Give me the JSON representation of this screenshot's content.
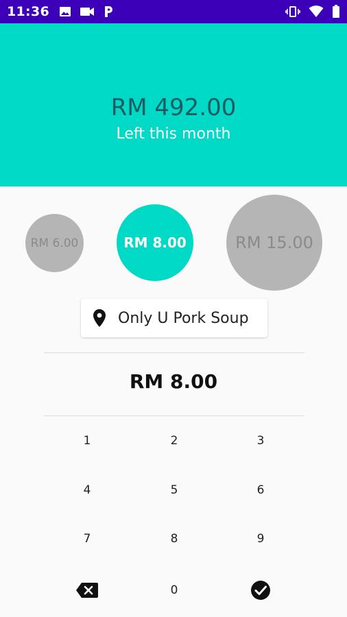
{
  "status_bar": {
    "time": "11:36",
    "icons_left": [
      "image-icon",
      "video-icon",
      "parking-icon"
    ],
    "icons_right": [
      "vibrate-icon",
      "wifi-icon",
      "battery-icon"
    ],
    "bg_color": "#3b00b8"
  },
  "header": {
    "amount": "RM 492.00",
    "label": "Left this month",
    "bg_color": "#00d9c5"
  },
  "quick_amounts": [
    {
      "label": "RM 6.00",
      "selected": false
    },
    {
      "label": "RM 8.00",
      "selected": true
    },
    {
      "label": "RM 15.00",
      "selected": false
    }
  ],
  "location": {
    "icon": "location-pin-icon",
    "name": "Only U Pork Soup"
  },
  "entered_amount": "RM 8.00",
  "keypad": {
    "keys": [
      "1",
      "2",
      "3",
      "4",
      "5",
      "6",
      "7",
      "8",
      "9"
    ],
    "zero": "0",
    "backspace_icon": "backspace-icon",
    "confirm_icon": "check-circle-icon"
  },
  "colors": {
    "accent": "#00d9c5",
    "amount_dark": "#1c5b63",
    "inactive_bubble": "#b5b5b5"
  }
}
